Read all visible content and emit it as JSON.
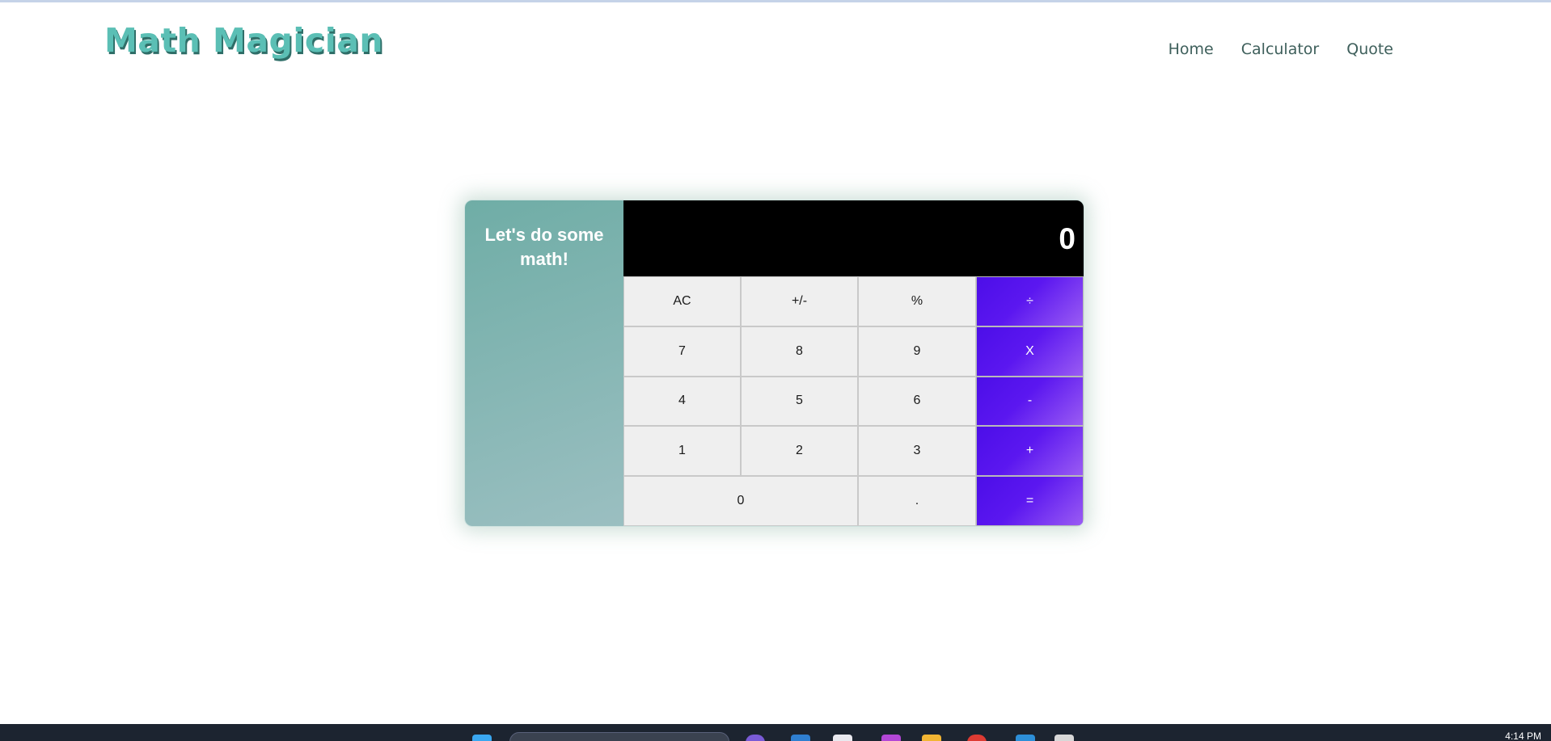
{
  "header": {
    "logo": "Math Magician",
    "nav": [
      "Home",
      "Calculator",
      "Quote"
    ]
  },
  "calculator": {
    "heading": "Let's do some math!",
    "display_value": "0",
    "keys": [
      {
        "label": "AC",
        "type": "func"
      },
      {
        "label": "+/-",
        "type": "func"
      },
      {
        "label": "%",
        "type": "func"
      },
      {
        "label": "÷",
        "type": "op"
      },
      {
        "label": "7",
        "type": "num"
      },
      {
        "label": "8",
        "type": "num"
      },
      {
        "label": "9",
        "type": "num"
      },
      {
        "label": "X",
        "type": "op"
      },
      {
        "label": "4",
        "type": "num"
      },
      {
        "label": "5",
        "type": "num"
      },
      {
        "label": "6",
        "type": "num"
      },
      {
        "label": "-",
        "type": "op"
      },
      {
        "label": "1",
        "type": "num"
      },
      {
        "label": "2",
        "type": "num"
      },
      {
        "label": "3",
        "type": "num"
      },
      {
        "label": "+",
        "type": "op"
      },
      {
        "label": "0",
        "type": "num"
      },
      {
        "label": ".",
        "type": "num"
      },
      {
        "label": "=",
        "type": "op"
      }
    ]
  },
  "taskbar": {
    "clock": "4:14 PM"
  },
  "colors": {
    "logo": "#5bbfb5",
    "operator_start": "#4c0ee8",
    "operator_end": "#9a5cf3",
    "panel": "#6fada6",
    "display_bg": "#000000"
  }
}
